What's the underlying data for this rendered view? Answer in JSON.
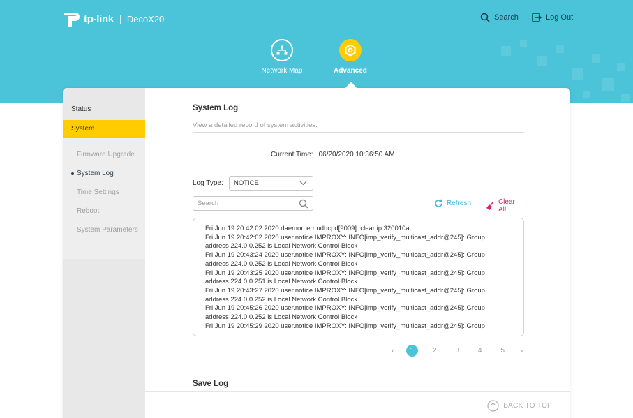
{
  "brand": {
    "name": "tp-link",
    "model": "DecoX20"
  },
  "header": {
    "search_label": "Search",
    "logout_label": "Log Out",
    "nav": [
      {
        "label": "Network Map",
        "icon": "network-map-icon"
      },
      {
        "label": "Advanced",
        "icon": "gear-icon"
      }
    ]
  },
  "sidebar": {
    "status_label": "Status",
    "system_label": "System",
    "items": [
      {
        "label": "Firmware Upgrade"
      },
      {
        "label": "System Log"
      },
      {
        "label": "Time Settings"
      },
      {
        "label": "Reboot"
      },
      {
        "label": "System Parameters"
      }
    ]
  },
  "system_log": {
    "title": "System Log",
    "description": "View a detailed record of system activities.",
    "current_time_label": "Current Time:",
    "current_time_value": "06/20/2020 10:36:50 AM",
    "log_type_label": "Log Type:",
    "log_type_value": "NOTICE",
    "search_placeholder": "Search",
    "refresh_label": "Refresh",
    "clear_all_label": "Clear All",
    "log_lines": [
      "Fri Jun 19 20:42:02 2020 daemon.err udhcpd[9009]: clear ip 320010ac",
      "Fri Jun 19 20:42:02 2020 user.notice IMPROXY: INFO[imp_verify_multicast_addr@245]: Group",
      "address 224.0.0.252 is Local Network Control Block",
      "Fri Jun 19 20:43:24 2020 user.notice IMPROXY: INFO[imp_verify_multicast_addr@245]: Group",
      "address 224.0.0.252 is Local Network Control Block",
      "Fri Jun 19 20:43:25 2020 user.notice IMPROXY: INFO[imp_verify_multicast_addr@245]: Group",
      "address 224.0.0.251 is Local Network Control Block",
      "Fri Jun 19 20:43:27 2020 user.notice IMPROXY: INFO[imp_verify_multicast_addr@245]: Group",
      "address 224.0.0.252 is Local Network Control Block",
      "Fri Jun 19 20:45:26 2020 user.notice IMPROXY: INFO[imp_verify_multicast_addr@245]: Group",
      "address 224.0.0.252 is Local Network Control Block",
      "Fri Jun 19 20:45:29 2020 user.notice IMPROXY: INFO[imp_verify_multicast_addr@245]: Group"
    ],
    "pagination": {
      "prev": "‹",
      "next": "›",
      "pages": [
        "1",
        "2",
        "3",
        "4",
        "5"
      ],
      "current": "1"
    }
  },
  "save_log": {
    "title": "Save Log"
  },
  "footer": {
    "back_to_top_label": "BACK TO TOP"
  },
  "colors": {
    "header_bg": "#4bc3d9",
    "accent_yellow": "#ffcc00",
    "refresh": "#3ab7d6",
    "clear_all": "#d6226a"
  }
}
